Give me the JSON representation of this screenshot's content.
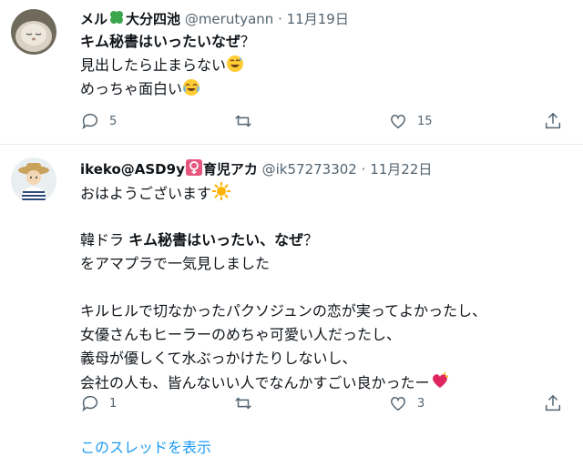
{
  "tweets": [
    {
      "name": "メル",
      "name_suffix": "大分四池",
      "handle": "@merutyann",
      "sep": "·",
      "date": "11月19日",
      "lines": [
        {
          "bold": "キム秘書はいったいなぜ",
          "rest": "？"
        },
        {
          "text": "見出したら止まらない"
        },
        {
          "text": "めっちゃ面白い"
        }
      ],
      "actions": {
        "reply": "5",
        "retweet": "",
        "like": "15"
      }
    },
    {
      "name": "ikeko@ASD9y",
      "name_suffix": "育児アカ",
      "handle": "@ik57273302",
      "sep": "·",
      "date": "11月22日",
      "lines": {
        "l1": "おはようございます",
        "l2a": "韓ドラ ",
        "l2b": "キム秘書はいったい、なぜ",
        "l2c": "？",
        "l3": "をアマプラで一気見しました",
        "l4": "キルヒルで切なかったパクソジュンの恋が実ってよかったし、",
        "l5": "女優さんもヒーラーのめちゃ可愛い人だったし、",
        "l6": "義母が優しくて水ぶっかけたりしないし、",
        "l7": "会社の人も、皆んないい人でなんかすごい良かったー"
      },
      "actions": {
        "reply": "1",
        "retweet": "",
        "like": "3"
      }
    }
  ],
  "show_thread": "このスレッドを表示",
  "colors": {
    "accent": "#1d9bf0",
    "muted": "#536471",
    "divider": "#e6ecf0"
  },
  "icons": [
    "reply-icon",
    "retweet-icon",
    "like-icon",
    "share-icon",
    "clover-icon",
    "female-sign-icon",
    "sweat-smile-emoji",
    "joy-emoji",
    "sun-emoji",
    "heart-emoji"
  ]
}
